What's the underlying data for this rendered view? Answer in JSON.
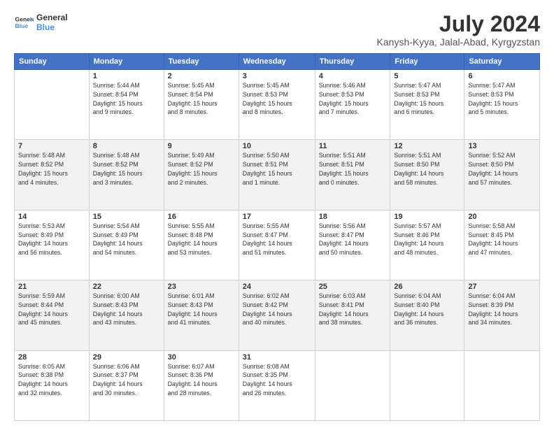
{
  "logo": {
    "line1": "General",
    "line2": "Blue"
  },
  "title": "July 2024",
  "location": "Kanysh-Kyya, Jalal-Abad, Kyrgyzstan",
  "headers": [
    "Sunday",
    "Monday",
    "Tuesday",
    "Wednesday",
    "Thursday",
    "Friday",
    "Saturday"
  ],
  "weeks": [
    [
      {
        "day": "",
        "info": ""
      },
      {
        "day": "1",
        "info": "Sunrise: 5:44 AM\nSunset: 8:54 PM\nDaylight: 15 hours\nand 9 minutes."
      },
      {
        "day": "2",
        "info": "Sunrise: 5:45 AM\nSunset: 8:54 PM\nDaylight: 15 hours\nand 8 minutes."
      },
      {
        "day": "3",
        "info": "Sunrise: 5:45 AM\nSunset: 8:53 PM\nDaylight: 15 hours\nand 8 minutes."
      },
      {
        "day": "4",
        "info": "Sunrise: 5:46 AM\nSunset: 8:53 PM\nDaylight: 15 hours\nand 7 minutes."
      },
      {
        "day": "5",
        "info": "Sunrise: 5:47 AM\nSunset: 8:53 PM\nDaylight: 15 hours\nand 6 minutes."
      },
      {
        "day": "6",
        "info": "Sunrise: 5:47 AM\nSunset: 8:53 PM\nDaylight: 15 hours\nand 5 minutes."
      }
    ],
    [
      {
        "day": "7",
        "info": "Sunrise: 5:48 AM\nSunset: 8:52 PM\nDaylight: 15 hours\nand 4 minutes."
      },
      {
        "day": "8",
        "info": "Sunrise: 5:48 AM\nSunset: 8:52 PM\nDaylight: 15 hours\nand 3 minutes."
      },
      {
        "day": "9",
        "info": "Sunrise: 5:49 AM\nSunset: 8:52 PM\nDaylight: 15 hours\nand 2 minutes."
      },
      {
        "day": "10",
        "info": "Sunrise: 5:50 AM\nSunset: 8:51 PM\nDaylight: 15 hours\nand 1 minute."
      },
      {
        "day": "11",
        "info": "Sunrise: 5:51 AM\nSunset: 8:51 PM\nDaylight: 15 hours\nand 0 minutes."
      },
      {
        "day": "12",
        "info": "Sunrise: 5:51 AM\nSunset: 8:50 PM\nDaylight: 14 hours\nand 58 minutes."
      },
      {
        "day": "13",
        "info": "Sunrise: 5:52 AM\nSunset: 8:50 PM\nDaylight: 14 hours\nand 57 minutes."
      }
    ],
    [
      {
        "day": "14",
        "info": "Sunrise: 5:53 AM\nSunset: 8:49 PM\nDaylight: 14 hours\nand 56 minutes."
      },
      {
        "day": "15",
        "info": "Sunrise: 5:54 AM\nSunset: 8:49 PM\nDaylight: 14 hours\nand 54 minutes."
      },
      {
        "day": "16",
        "info": "Sunrise: 5:55 AM\nSunset: 8:48 PM\nDaylight: 14 hours\nand 53 minutes."
      },
      {
        "day": "17",
        "info": "Sunrise: 5:55 AM\nSunset: 8:47 PM\nDaylight: 14 hours\nand 51 minutes."
      },
      {
        "day": "18",
        "info": "Sunrise: 5:56 AM\nSunset: 8:47 PM\nDaylight: 14 hours\nand 50 minutes."
      },
      {
        "day": "19",
        "info": "Sunrise: 5:57 AM\nSunset: 8:46 PM\nDaylight: 14 hours\nand 48 minutes."
      },
      {
        "day": "20",
        "info": "Sunrise: 5:58 AM\nSunset: 8:45 PM\nDaylight: 14 hours\nand 47 minutes."
      }
    ],
    [
      {
        "day": "21",
        "info": "Sunrise: 5:59 AM\nSunset: 8:44 PM\nDaylight: 14 hours\nand 45 minutes."
      },
      {
        "day": "22",
        "info": "Sunrise: 6:00 AM\nSunset: 8:43 PM\nDaylight: 14 hours\nand 43 minutes."
      },
      {
        "day": "23",
        "info": "Sunrise: 6:01 AM\nSunset: 8:43 PM\nDaylight: 14 hours\nand 41 minutes."
      },
      {
        "day": "24",
        "info": "Sunrise: 6:02 AM\nSunset: 8:42 PM\nDaylight: 14 hours\nand 40 minutes."
      },
      {
        "day": "25",
        "info": "Sunrise: 6:03 AM\nSunset: 8:41 PM\nDaylight: 14 hours\nand 38 minutes."
      },
      {
        "day": "26",
        "info": "Sunrise: 6:04 AM\nSunset: 8:40 PM\nDaylight: 14 hours\nand 36 minutes."
      },
      {
        "day": "27",
        "info": "Sunrise: 6:04 AM\nSunset: 8:39 PM\nDaylight: 14 hours\nand 34 minutes."
      }
    ],
    [
      {
        "day": "28",
        "info": "Sunrise: 6:05 AM\nSunset: 8:38 PM\nDaylight: 14 hours\nand 32 minutes."
      },
      {
        "day": "29",
        "info": "Sunrise: 6:06 AM\nSunset: 8:37 PM\nDaylight: 14 hours\nand 30 minutes."
      },
      {
        "day": "30",
        "info": "Sunrise: 6:07 AM\nSunset: 8:36 PM\nDaylight: 14 hours\nand 28 minutes."
      },
      {
        "day": "31",
        "info": "Sunrise: 6:08 AM\nSunset: 8:35 PM\nDaylight: 14 hours\nand 26 minutes."
      },
      {
        "day": "",
        "info": ""
      },
      {
        "day": "",
        "info": ""
      },
      {
        "day": "",
        "info": ""
      }
    ]
  ]
}
